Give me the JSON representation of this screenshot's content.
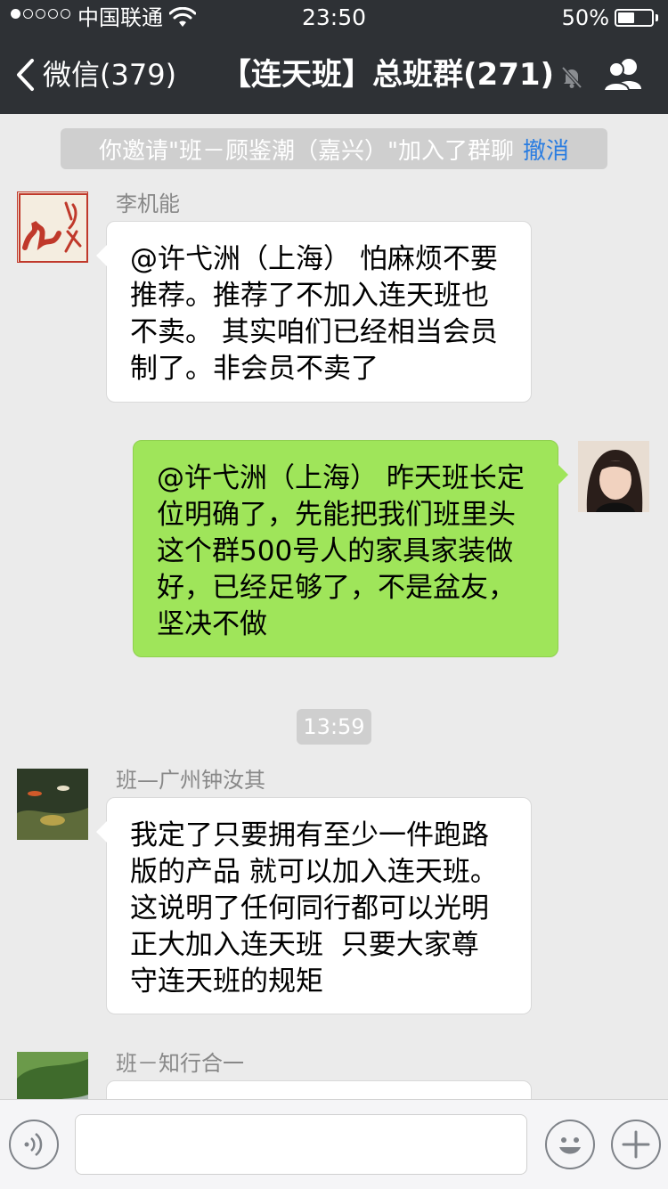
{
  "status_bar": {
    "carrier": "中国联通",
    "time": "23:50",
    "battery_percent": "50%",
    "battery_level": 0.5,
    "signal_bars_filled": 1,
    "signal_bars_total": 5
  },
  "nav": {
    "back_label": "微信(379)",
    "title": "【连天班】总班群(271)",
    "icons": [
      "chevron-left-icon",
      "mute-bell-icon",
      "group-members-icon"
    ]
  },
  "system_notice": {
    "text": "你邀请\"班－顾鉴潮（嘉兴）\"加入了群聊",
    "action": "撤消"
  },
  "messages": [
    {
      "sender": "李机能",
      "side": "left",
      "text": "@许弋洲（上海） 怕麻烦不要\n推荐。推荐了不加入连天班也\n不卖。 其实咱们已经相当会员\n制了。非会员不卖了",
      "avatar_text": "红连天"
    },
    {
      "sender": "",
      "side": "right",
      "text": "@许弋洲（上海） 昨天班长定\n位明确了，先能把我们班里头\n这个群500号人的家具家装做\n好，已经足够了，不是盆友，\n坚决不做"
    },
    {
      "sender": "班—广州钟汝其",
      "side": "left",
      "text": "我定了只要拥有至少一件跑路\n版的产品 就可以加入连天班。\n这说明了任何同行都可以光明\n正大加入连天班  只要大家尊\n守连天班的规矩"
    },
    {
      "sender": "班－知行合一",
      "side": "left",
      "text": ""
    }
  ],
  "time_divider": "13:59",
  "input_bar": {
    "placeholder": "",
    "icons": [
      "voice-icon",
      "emoji-icon",
      "plus-icon"
    ]
  },
  "colors": {
    "nav_bg": "#2e3135",
    "chat_bg": "#ebebeb",
    "bubble_self": "#9fe55a",
    "bubble_other": "#ffffff",
    "link": "#2a7de1"
  }
}
